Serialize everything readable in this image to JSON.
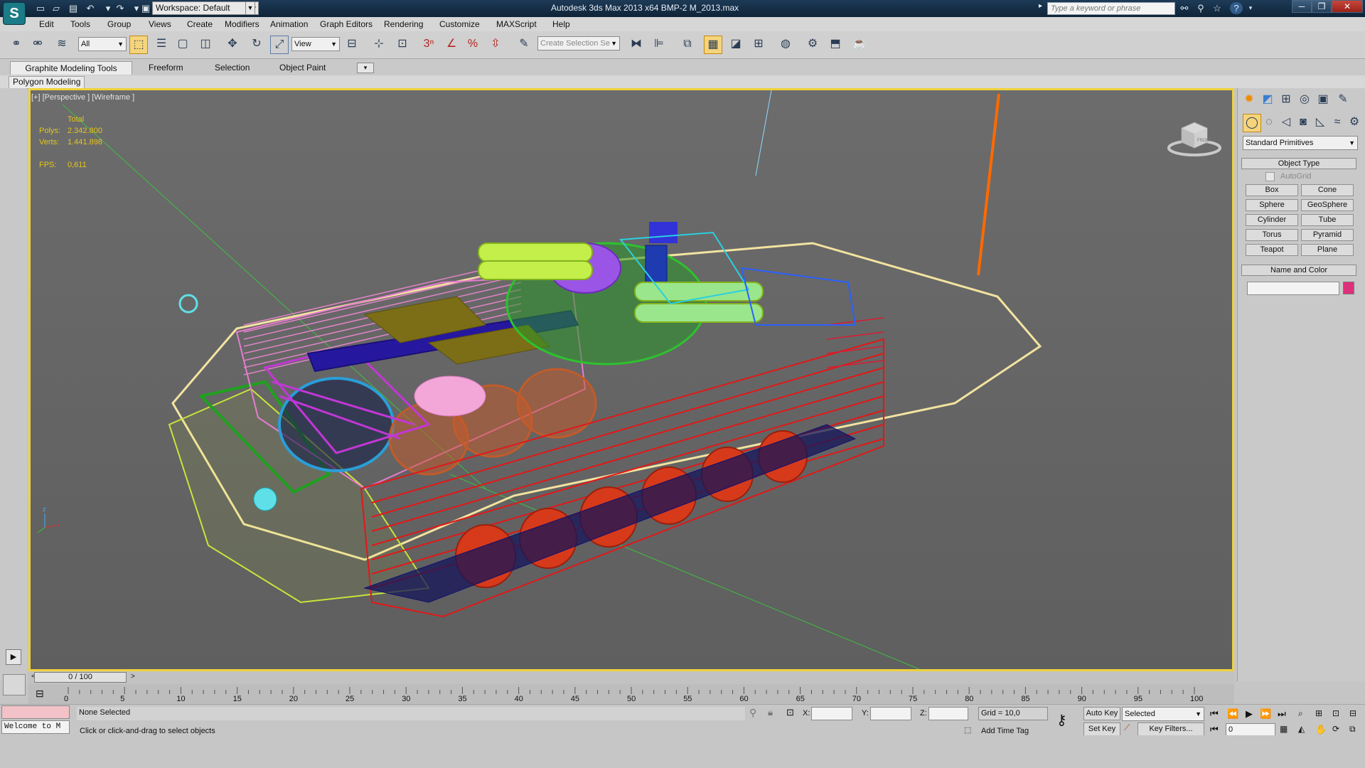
{
  "title_bar": {
    "app_title": "Autodesk 3ds Max  2013 x64     BMP-2 M_2013.max",
    "workspace": "Workspace: Default",
    "search_placeholder": "Type a keyword or phrase"
  },
  "menu": [
    "Edit",
    "Tools",
    "Group",
    "Views",
    "Create",
    "Modifiers",
    "Animation",
    "Graph Editors",
    "Rendering",
    "Customize",
    "MAXScript",
    "Help"
  ],
  "toolbar": {
    "selection_filter": "All",
    "ref_coord": "View",
    "named_selection_placeholder": "Create Selection Se",
    "snap_label": "3"
  },
  "ribbon": {
    "tabs": [
      "Graphite Modeling Tools",
      "Freeform",
      "Selection",
      "Object Paint"
    ],
    "panel": "Polygon Modeling"
  },
  "viewport": {
    "label": "[+] [Perspective ] [Wireframe ]",
    "stats": {
      "header": "Total",
      "polys_label": "Polys:",
      "polys_value": "2.342.800",
      "verts_label": "Verts:",
      "verts_value": "1.441.898",
      "fps_label": "FPS:",
      "fps_value": "0,611"
    },
    "viewcube_label": "FRONT"
  },
  "command_panel": {
    "category": "Standard Primitives",
    "object_type_title": "Object Type",
    "autogrid": "AutoGrid",
    "buttons": [
      "Box",
      "Cone",
      "Sphere",
      "GeoSphere",
      "Cylinder",
      "Tube",
      "Torus",
      "Pyramid",
      "Teapot",
      "Plane"
    ],
    "name_color_title": "Name and Color",
    "object_color": "#e0307a"
  },
  "timeline": {
    "slider": "0 / 100",
    "ticks": [
      "0",
      "5",
      "10",
      "15",
      "20",
      "25",
      "30",
      "35",
      "40",
      "45",
      "50",
      "55",
      "60",
      "65",
      "70",
      "75",
      "80",
      "85",
      "90",
      "95",
      "100"
    ]
  },
  "status": {
    "selection": "None Selected",
    "prompt": "Click or click-and-drag to select objects",
    "maxscript": "Welcome to M",
    "x_label": "X:",
    "y_label": "Y:",
    "z_label": "Z:",
    "grid": "Grid = 10,0",
    "add_time_tag": "Add Time Tag",
    "auto_key": "Auto Key",
    "set_key": "Set Key",
    "key_mode": "Selected",
    "key_filters": "Key Filters...",
    "frame": "0"
  },
  "colors": {
    "viewport_border": "#f0d23a",
    "stats_text": "#e6c51a",
    "title_bg": "#163049"
  }
}
